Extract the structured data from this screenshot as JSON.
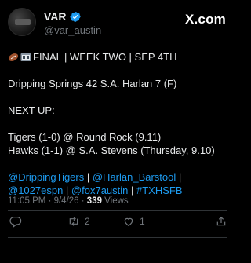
{
  "header": {
    "name": "VAR",
    "handle": "@var_austin",
    "brand": "X.com"
  },
  "post": {
    "line1": "FINAL | WEEK TWO | SEP 4TH",
    "line2": "Dripping Springs 42 S.A. Harlan 7 (F)",
    "line3": "NEXT UP:",
    "line4": "Tigers (1-0) @ Round Rock (9.11)",
    "line5": "Hawks (1-1) @ S.A. Stevens (Thursday, 9.10)",
    "mentions_line1": [
      "@DrippingTigers",
      " | ",
      "@Harlan_Barstool",
      " |"
    ],
    "mentions_line2": [
      "@1027espn",
      " | ",
      "@fox7austin",
      " | ",
      "#TXHSFB"
    ]
  },
  "meta": {
    "time_date": "11:05 PM · 9/4/26 · ",
    "views_count": "339",
    "views_label": " Views"
  },
  "actions": {
    "reply": "",
    "retweet_count": "2",
    "like_count": "1"
  },
  "colors": {
    "background": "#000000",
    "link": "#1d9bf0",
    "muted": "#71767b",
    "verified": "#1d9bf0"
  }
}
